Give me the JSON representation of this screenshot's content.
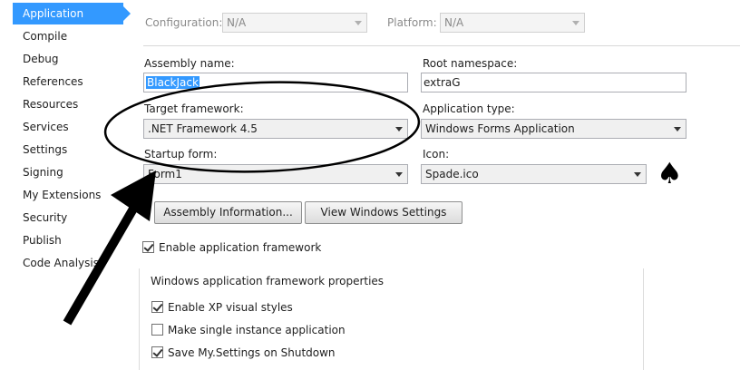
{
  "sidebar": {
    "items": [
      {
        "label": "Application",
        "active": true
      },
      {
        "label": "Compile"
      },
      {
        "label": "Debug"
      },
      {
        "label": "References"
      },
      {
        "label": "Resources"
      },
      {
        "label": "Services"
      },
      {
        "label": "Settings"
      },
      {
        "label": "Signing"
      },
      {
        "label": "My Extensions"
      },
      {
        "label": "Security"
      },
      {
        "label": "Publish"
      },
      {
        "label": "Code Analysis"
      }
    ]
  },
  "config_bar": {
    "configuration_label": "Configuration:",
    "configuration_value": "N/A",
    "platform_label": "Platform:",
    "platform_value": "N/A"
  },
  "form": {
    "assembly_name_label": "Assembly name:",
    "assembly_name_value": "BlackJack",
    "root_namespace_label": "Root namespace:",
    "root_namespace_value": "extraG",
    "target_framework_label": "Target framework:",
    "target_framework_value": ".NET Framework 4.5",
    "application_type_label": "Application type:",
    "application_type_value": "Windows Forms Application",
    "startup_form_label": "Startup form:",
    "startup_form_value": "Form1",
    "icon_label": "Icon:",
    "icon_value": "Spade.ico",
    "icon_preview": "♠"
  },
  "buttons": {
    "assembly_information": "Assembly Information...",
    "view_windows_settings": "View Windows Settings"
  },
  "enable_framework": {
    "label": "Enable application framework",
    "checked": true
  },
  "framework_group": {
    "title": "Windows application framework properties",
    "options": [
      {
        "label": "Enable XP visual styles",
        "checked": true
      },
      {
        "label": "Make single instance application",
        "checked": false
      },
      {
        "label": "Save My.Settings on Shutdown",
        "checked": true
      }
    ]
  }
}
